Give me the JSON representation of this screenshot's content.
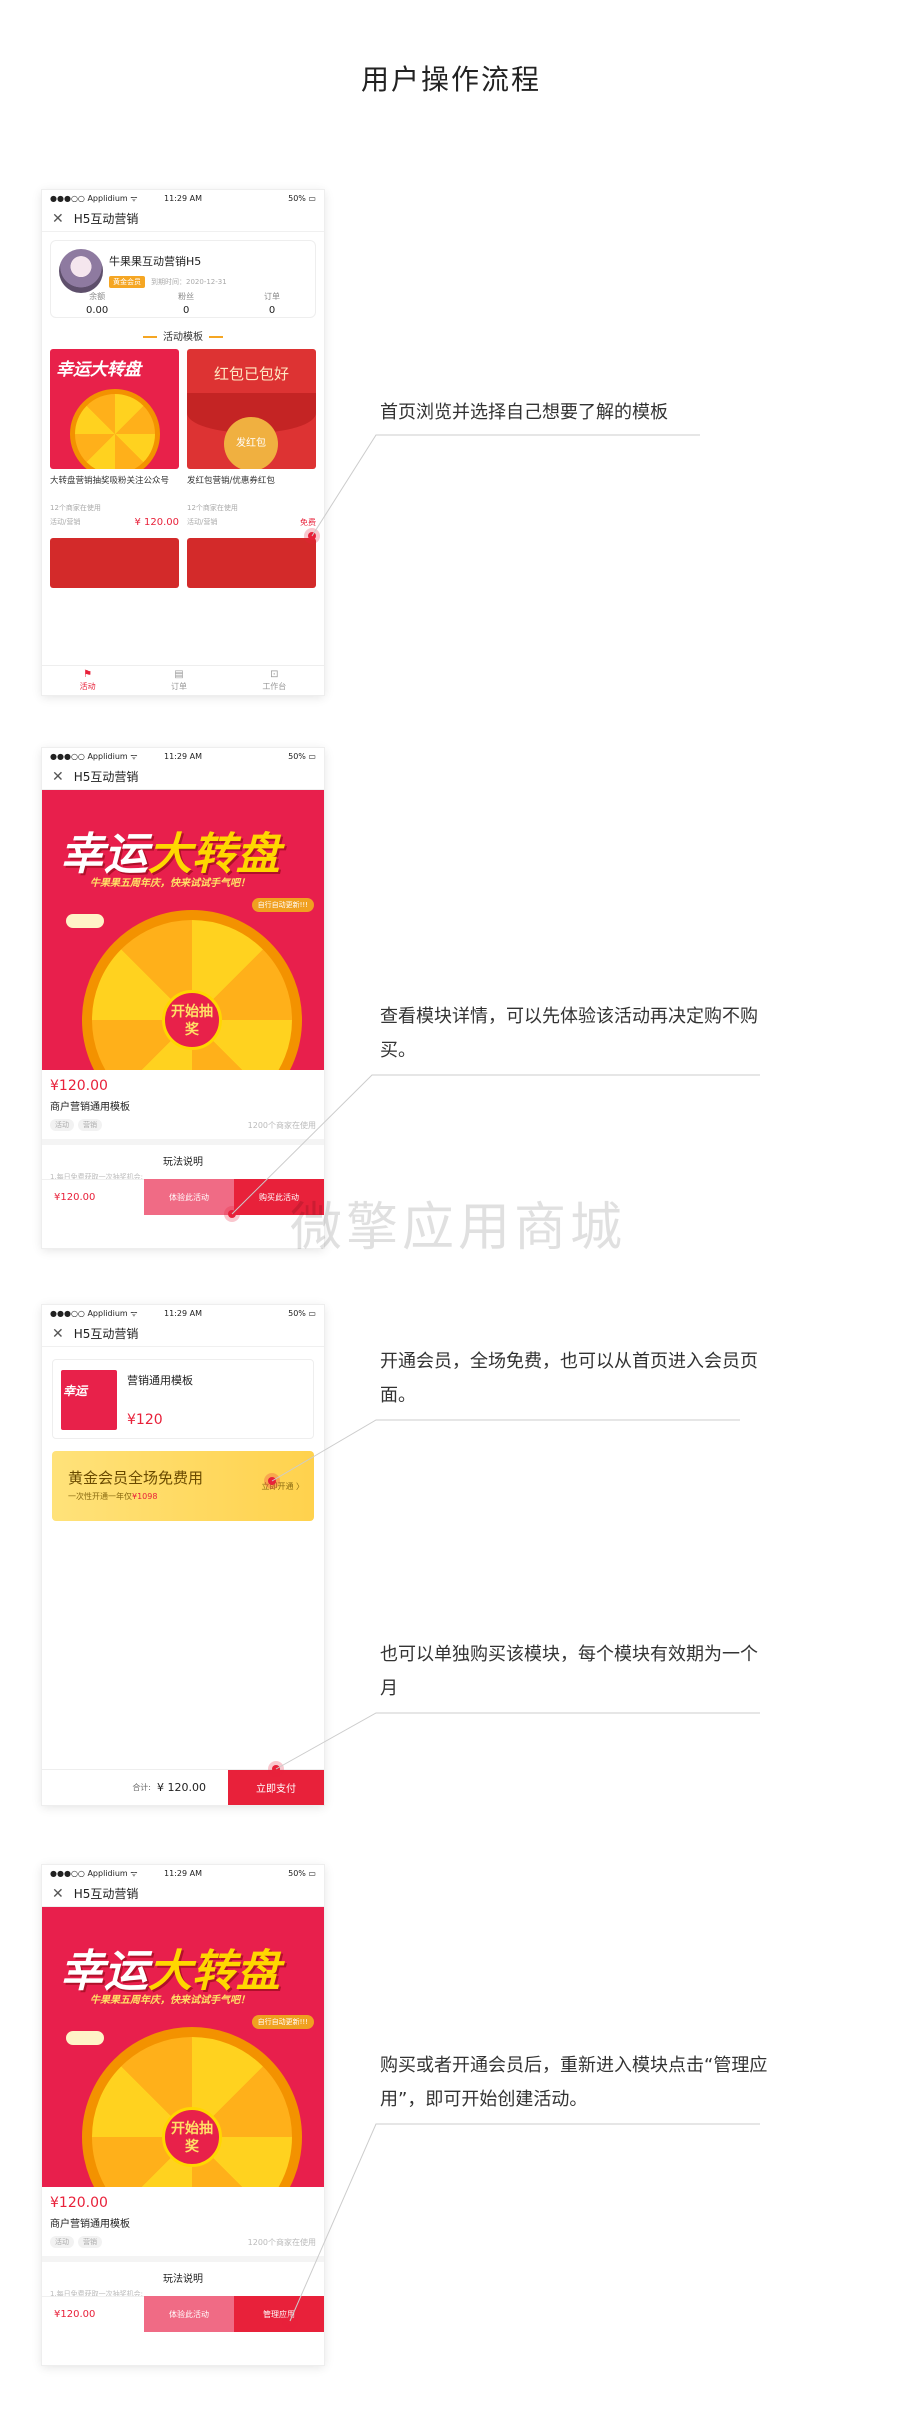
{
  "page_title": "用户操作流程",
  "watermark": "微擎应用商城",
  "status": {
    "carrier": "●●●○○ Applidium ᯤ",
    "time": "11:29 AM",
    "battery": "50% ▭"
  },
  "phone1": {
    "nav_title": "H5互动营销",
    "shop_name": "牛果果互动营销H5",
    "member_badge": "黄金会员",
    "expire": "到期时间：2020-12-31",
    "stats": [
      {
        "label": "余额",
        "value": "0.00"
      },
      {
        "label": "粉丝",
        "value": "0"
      },
      {
        "label": "订单",
        "value": "0"
      }
    ],
    "section": "活动模板",
    "cards": [
      {
        "thumb_text": "幸运大转盘",
        "title": "大转盘营销抽奖吸粉关注公众号",
        "sub": "12个商家在使用",
        "tag": "活动/营销",
        "price": "¥ 120.00"
      },
      {
        "thumb_text": "红包已包好",
        "btn": "发红包",
        "title": "发红包营销/优惠券红包",
        "sub": "12个商家在使用",
        "tag": "活动/营销",
        "price": "免费"
      }
    ],
    "tabs": [
      {
        "label": "活动",
        "icon": "⚑"
      },
      {
        "label": "订单",
        "icon": "▤"
      },
      {
        "label": "工作台",
        "icon": "⊡"
      }
    ]
  },
  "phone2": {
    "nav_title": "H5互动营销",
    "banner_title_a": "幸运",
    "banner_title_b": "大转盘",
    "banner_sub": "牛果果五周年庆，快来试试手气吧！",
    "banner_tag": "自行自动更新!!!",
    "wheel_center": "开始抽奖",
    "price": "¥120.00",
    "name": "商户营销通用模板",
    "tags": [
      "活动",
      "营销"
    ],
    "users": "1200个商家在使用",
    "rules_title": "玩法说明",
    "rules_text": "1.每日免费获取一次抽奖机会;",
    "bar_price": "¥120.00",
    "try_label": "体验此活动",
    "buy_label": "购买此活动"
  },
  "phone3": {
    "nav_title": "H5互动营销",
    "order_name": "营销通用模板",
    "order_thumb": "幸运",
    "order_price": "¥120",
    "vip_title": "黄金会员全场免费用",
    "vip_sub_a": "一次性开通一年仅",
    "vip_sub_b": "¥1098",
    "vip_btn": "立即开通 〉",
    "total_label": "合计:",
    "total_value": "¥ 120.00",
    "pay_label": "立即支付"
  },
  "phone4": {
    "nav_title": "H5互动营销",
    "price": "¥120.00",
    "name": "商户营销通用模板",
    "tags": [
      "活动",
      "营销"
    ],
    "users": "1200个商家在使用",
    "rules_title": "玩法说明",
    "rules_text": "1.每日免费获取一次抽奖机会;",
    "bar_price": "¥120.00",
    "try_label": "体验此活动",
    "manage_label": "管理应用"
  },
  "annotations": [
    "首页浏览并选择自己想要了解的模板",
    "查看模块详情，可以先体验该活动再决定购不购买。",
    "开通会员，全场免费，也可以从首页进入会员页面。",
    "也可以单独购买该模块，每个模块有效期为一个月",
    "购买或者开通会员后，重新进入模块点击“管理应用”，即可开始创建活动。"
  ]
}
